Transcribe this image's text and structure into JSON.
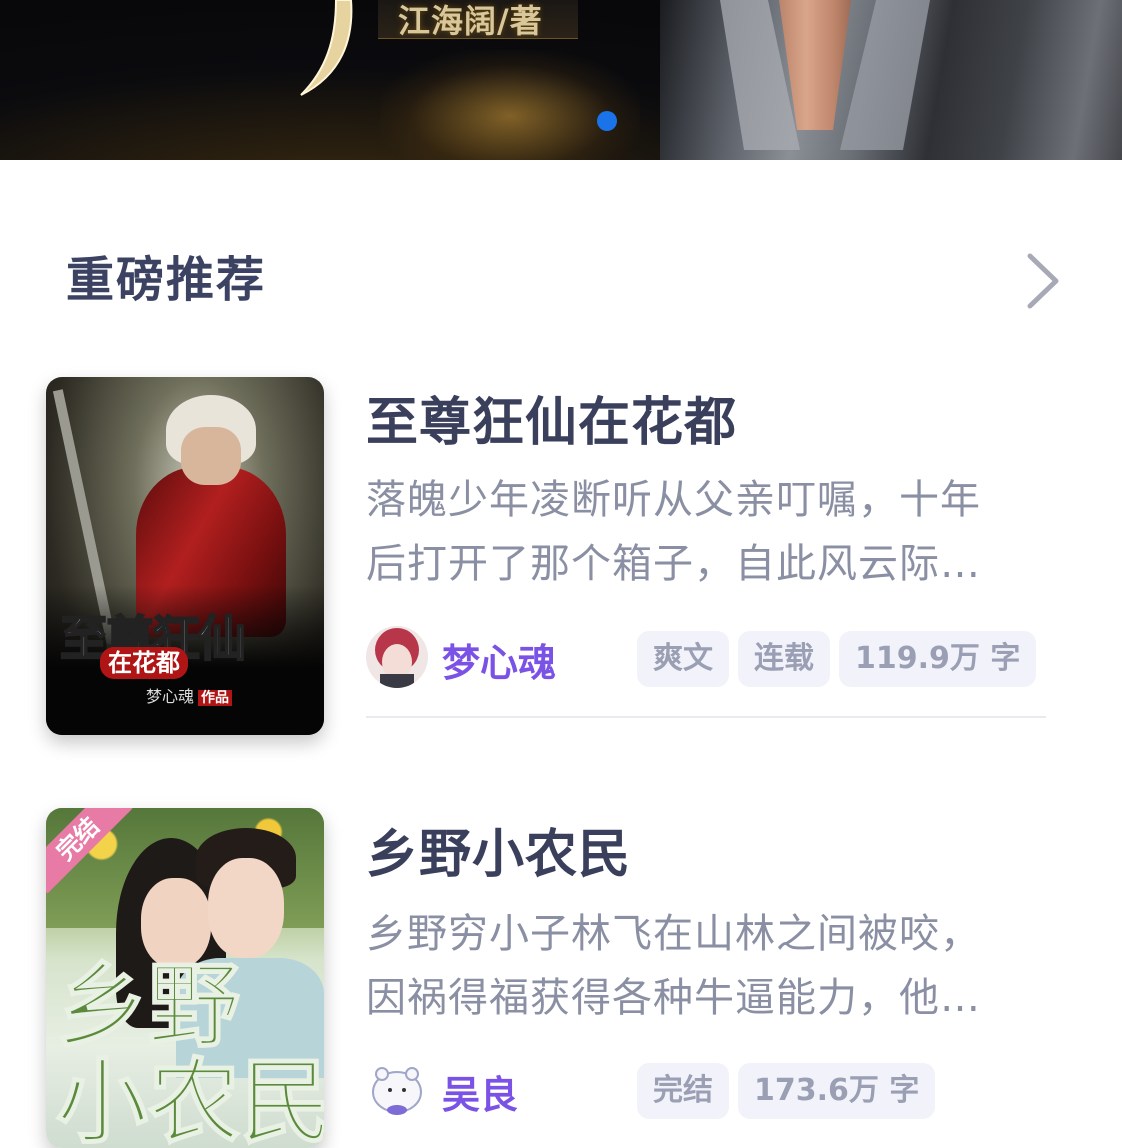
{
  "banner": {
    "author_credit": "江海阔/著",
    "carousel_dots": 1,
    "active_dot_color": "#1a73e8"
  },
  "section": {
    "title": "重磅推荐"
  },
  "books": [
    {
      "title": "至尊狂仙在花都",
      "description_line1": "落魄少年凌断听从父亲叮嘱，十年",
      "description_line2": "后打开了那个箱子，自此风云际…",
      "author": "梦心魂",
      "tags": [
        "爽文",
        "连载",
        "119.9万 字"
      ],
      "cover": {
        "title_main": "至尊狂仙",
        "title_sub": "在花都",
        "cover_author": "梦心魂",
        "cover_author_suffix": "作品"
      }
    },
    {
      "title": "乡野小农民",
      "description_line1": "乡野穷小子林飞在山林之间被咬，",
      "description_line2": "因祸得福获得各种牛逼能力，他…",
      "author": "吴良",
      "tags": [
        "完结",
        "173.6万 字"
      ],
      "cover": {
        "ribbon": "完结",
        "title_main": "乡野\n小农民"
      }
    }
  ],
  "colors": {
    "title": "#3a3f5c",
    "author": "#7b52e6",
    "description": "#8a8fa3",
    "tag_bg": "#f2f3fa",
    "tag_text": "#9a9fb4"
  }
}
